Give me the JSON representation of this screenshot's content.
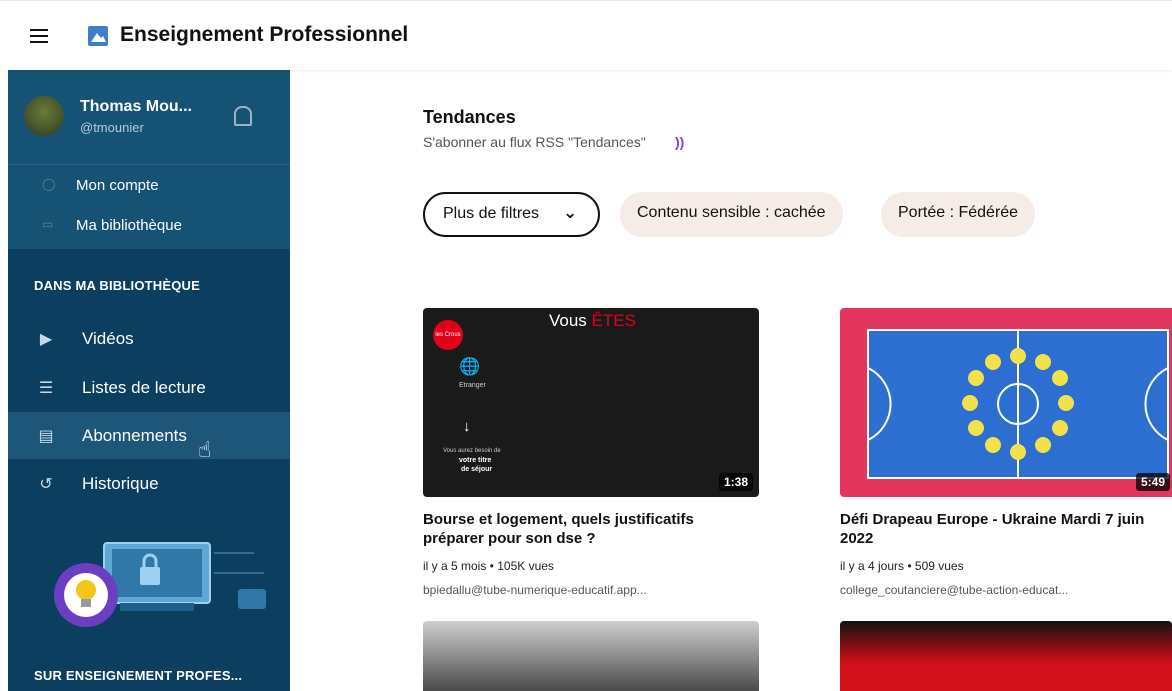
{
  "header": {
    "app_name": "Enseignement Professionnel",
    "menu_icon": "hamburger-icon",
    "logo_icon": "logo-icon"
  },
  "sidebar": {
    "user": {
      "name": "Thomas Mou...",
      "handle": "@tmounier"
    },
    "account_items": [
      {
        "label": "Mon compte",
        "icon": "user-icon"
      },
      {
        "label": "Ma bibliothèque",
        "icon": "tv-icon"
      }
    ],
    "section_library": "DANS MA BIBLIOTHÈQUE",
    "nav_items": [
      {
        "label": "Vidéos",
        "icon": "video-icon"
      },
      {
        "label": "Listes de lecture",
        "icon": "list-icon"
      },
      {
        "label": "Abonnements",
        "icon": "subscriptions-icon"
      },
      {
        "label": "Historique",
        "icon": "history-icon"
      }
    ],
    "section_site": "SUR ENSEIGNEMENT PROFES..."
  },
  "main": {
    "title": "Tendances",
    "rss_text": "S'abonner au flux RSS \"Tendances\"",
    "filter_button": "Plus de filtres",
    "chips": [
      "Contenu sensible : cachée",
      "Portée : Fédérée"
    ]
  },
  "videos": [
    {
      "title": "Bourse et logement, quels justificatifs préparer pour son dse ?",
      "meta": "il y a 5 mois • 105K vues",
      "account": "bpiedallu@tube-numerique-educatif.app...",
      "duration": "1:38",
      "thumb_text": {
        "heading": "Vous",
        "heading_accent": "ÊTES",
        "badge": "les Crous",
        "label": "Etranger",
        "line1": "Vous aurez besoin de",
        "line2": "votre titre",
        "line3": "de séjour"
      }
    },
    {
      "title": "Défi Drapeau Europe - Ukraine Mardi 7 juin 2022",
      "meta": "il y a 4 jours • 509 vues",
      "account": "college_coutanciere@tube-action-educat...",
      "duration": "5:49"
    }
  ],
  "colors": {
    "sidebar": "#0c3e5f",
    "sidebar_user": "#165274",
    "chip": "#f5ebe7",
    "rss": "#7c3aed"
  }
}
